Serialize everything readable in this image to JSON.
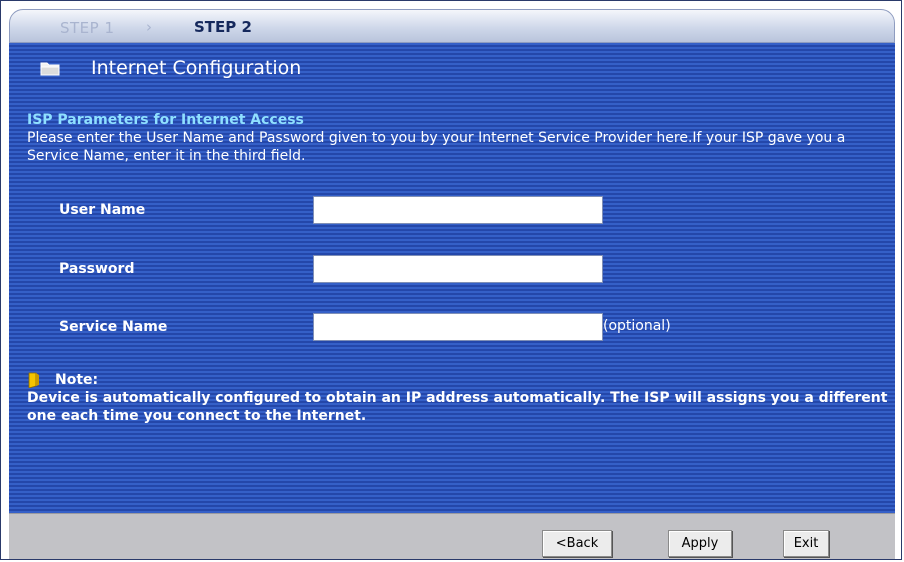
{
  "steps": {
    "step1": "STEP 1",
    "arrow": "›",
    "step2": "STEP 2"
  },
  "page": {
    "title": "Internet Configuration"
  },
  "section": {
    "title": "ISP Parameters for Internet Access",
    "instructions": "Please enter the User Name and Password given to you by your Internet Service Provider here.If your ISP gave you a Service Name, enter it in the third field."
  },
  "fields": {
    "username": {
      "label": "User Name",
      "value": ""
    },
    "password": {
      "label": "Password",
      "value": ""
    },
    "service_name": {
      "label": "Service Name",
      "value": "",
      "hint": "(optional)"
    }
  },
  "note": {
    "title": "Note:",
    "text": "Device is automatically configured to obtain an IP address automatically. The ISP will assigns you a different one each time you connect to the Internet."
  },
  "buttons": {
    "back": "<Back",
    "apply": "Apply",
    "exit": "Exit"
  },
  "icons": {
    "title_icon": "folder-icon",
    "note_icon": "note-icon"
  },
  "colors": {
    "background": "#2a4fb4",
    "section_title": "#8fe0ff",
    "button_bar": "#c2c2c6"
  }
}
